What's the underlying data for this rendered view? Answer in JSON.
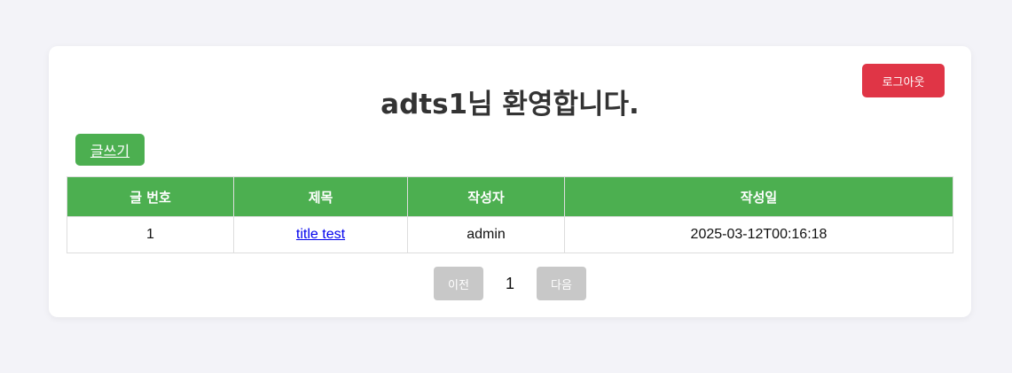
{
  "header": {
    "title": "adts1님 환영합니다.",
    "logout_label": "로그아웃"
  },
  "toolbar": {
    "write_label": "글쓰기"
  },
  "table": {
    "columns": [
      "글 번호",
      "제목",
      "작성자",
      "작성일"
    ],
    "rows": [
      {
        "no": "1",
        "title": "title test",
        "author": "admin",
        "date": "2025-03-12T00:16:18"
      }
    ]
  },
  "pagination": {
    "prev_label": "이전",
    "current_page": "1",
    "next_label": "다음"
  },
  "colors": {
    "primary": "#4caf50",
    "danger": "#e03546",
    "disabled": "#c8c8c8",
    "background": "#f3f3f8"
  }
}
